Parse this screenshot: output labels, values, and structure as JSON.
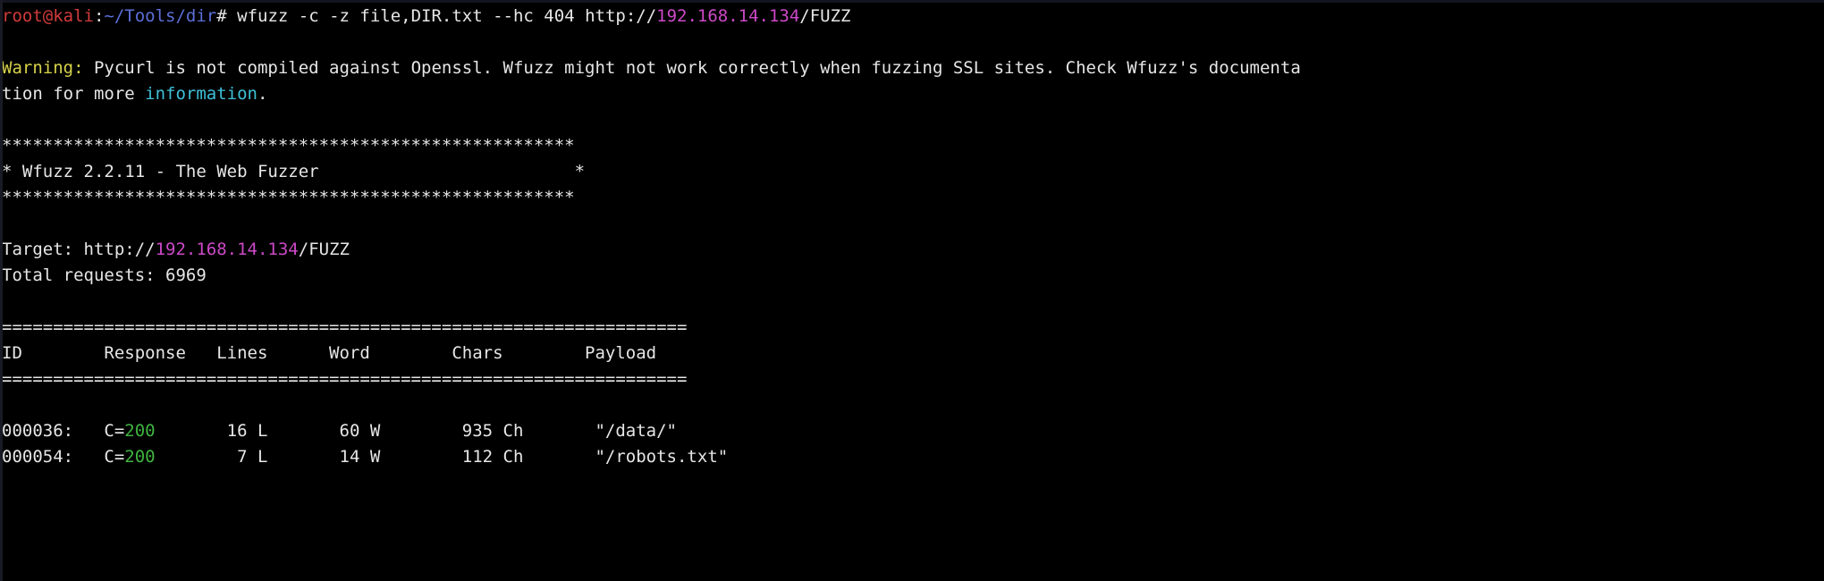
{
  "terminal": {
    "title": "wfuzz terminal session",
    "background_color": "#000000",
    "colors": {
      "user_host": "#d23b3b",
      "path": "#5c6fd8",
      "default_text": "#e6e6e6",
      "ip_address": "#cc49c7",
      "warning": "#d7d24a",
      "link": "#3fc0d8",
      "status_ok": "#3fb33f"
    }
  },
  "prompt": {
    "user_host": "root@kali",
    "separator": ":",
    "path": "~/Tools/dir",
    "symbol": "# ",
    "command_pre_ip": "wfuzz -c -z file,DIR.txt --hc 404 http://",
    "command_ip": "192.168.14.134",
    "command_post_ip": "/FUZZ"
  },
  "warning": {
    "label": "Warning:",
    "text_part1": " Pycurl is not compiled against Openssl. Wfuzz might not work correctly when fuzzing SSL sites. Check Wfuzz's documenta",
    "text_part2": "tion for more ",
    "link": "information",
    "text_part3": "."
  },
  "banner": {
    "rule": "********************************************************",
    "title_line": "* Wfuzz 2.2.11 - The Web Fuzzer                         *"
  },
  "target": {
    "label": "Target: http://",
    "ip": "192.168.14.134",
    "path": "/FUZZ",
    "total_requests_label": "Total requests: ",
    "total_requests_value": "6969"
  },
  "table": {
    "rule": "===================================================================",
    "headers": {
      "id": "ID",
      "response": "Response",
      "lines": "Lines",
      "word": "Word",
      "chars": "Chars",
      "payload": "Payload"
    },
    "header_line": "ID        Response   Lines      Word        Chars        Payload",
    "rows": [
      {
        "id": "000036:",
        "response_prefix": "C=",
        "response_code": "200",
        "lines": "16 L",
        "word": "60 W",
        "chars": "935 Ch",
        "payload": "\"/data/\"",
        "raw_pre": "000036:   C=",
        "raw_post": "       16 L       60 W        935 Ch       \"/data/\""
      },
      {
        "id": "000054:",
        "response_prefix": "C=",
        "response_code": "200",
        "lines": "7 L",
        "word": "14 W",
        "chars": "112 Ch",
        "payload": "\"/robots.txt\"",
        "raw_pre": "000054:   C=",
        "raw_post": "        7 L       14 W        112 Ch       \"/robots.txt\""
      }
    ]
  }
}
